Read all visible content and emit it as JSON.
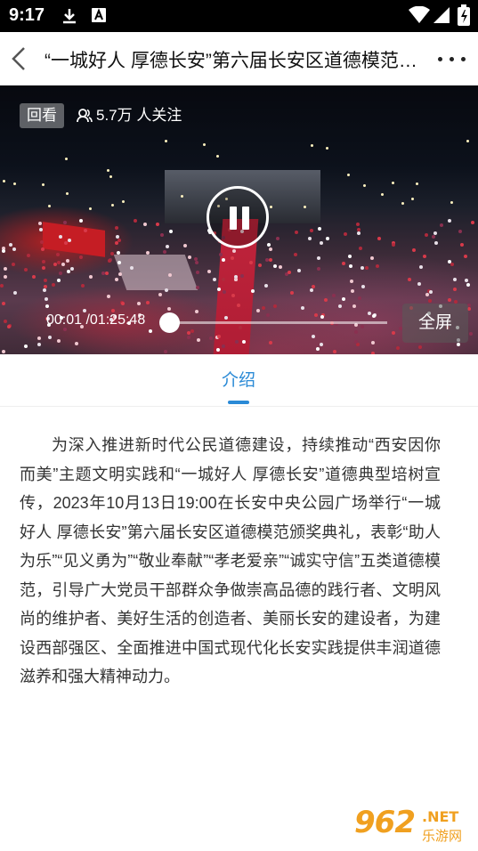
{
  "status_bar": {
    "time": "9:17"
  },
  "header": {
    "title": "“一城好人 厚德长安”第六届长安区道德模范颁奖典礼"
  },
  "video": {
    "badge": "回看",
    "viewers": "5.7万 人关注",
    "time_current": "00:01",
    "time_total": "01:25:48",
    "time_display": "00:01 /01:25:48",
    "progress": 0.0002,
    "fullscreen_label": "全屏"
  },
  "tabs": [
    {
      "label": "介绍",
      "active": true
    }
  ],
  "intro": {
    "text": "为深入推进新时代公民道德建设，持续推动“西安因你而美”主题文明实践和“一城好人 厚德长安”道德典型培树宣传，2023年10月13日19:00在长安中央公园广场举行“一城好人 厚德长安”第六届长安区道德模范颁奖典礼，表彰“助人为乐”“见义勇为”“敬业奉献”“孝老爱亲”“诚实守信”五类道德模范，引导广大党员干部群众争做崇高品德的践行者、文明风尚的维护者、美好生活的创造者、美丽长安的建设者，为建设西部强区、全面推进中国式现代化长安实践提供丰润道德滋养和强大精神动力。"
  },
  "watermark": {
    "number": "962",
    "domain": ".NET",
    "name": "乐游网"
  },
  "colors": {
    "accent": "#2a8ad6",
    "status_bar": "#000000"
  }
}
